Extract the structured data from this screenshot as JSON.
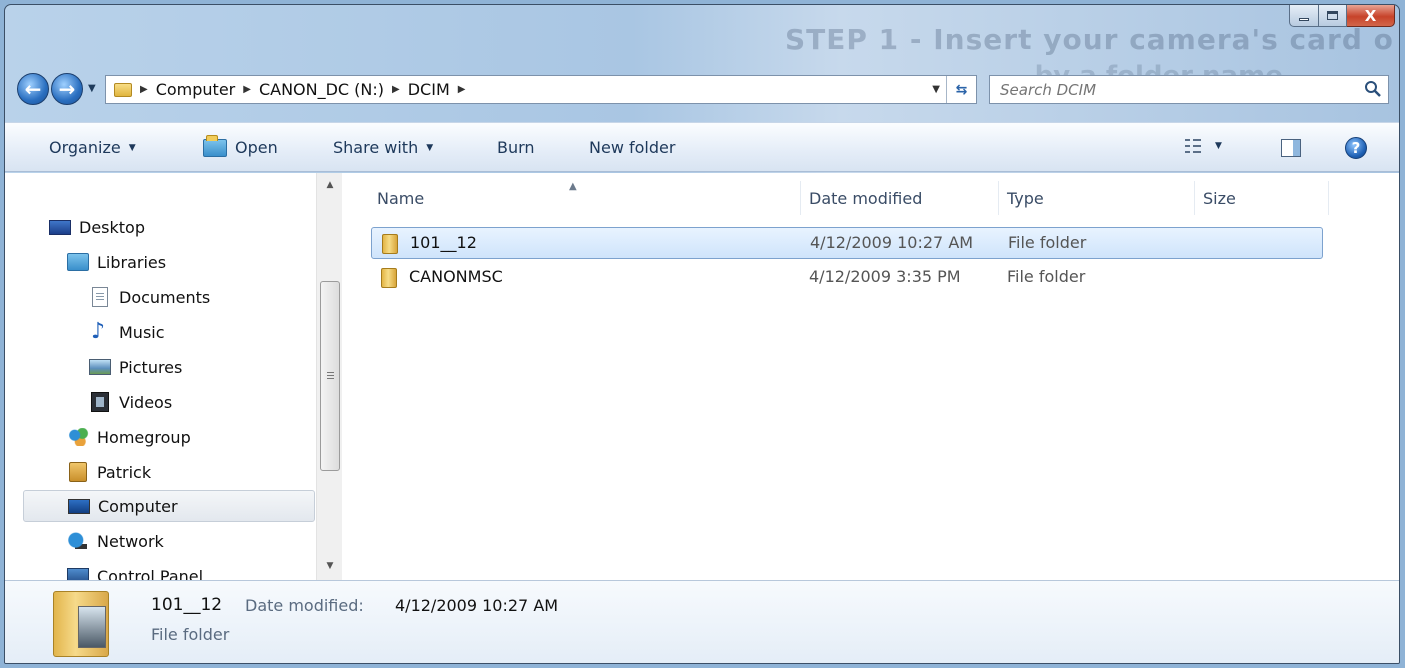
{
  "window": {
    "caption": {
      "close": "X"
    },
    "background_text": [
      "STEP 1 -  Insert your camera's card o",
      "...by a folder name"
    ]
  },
  "navigation": {
    "breadcrumbs": [
      "Computer",
      "CANON_DC (N:)",
      "DCIM"
    ],
    "search_placeholder": "Search DCIM"
  },
  "commands": {
    "organize": "Organize",
    "open": "Open",
    "share_with": "Share with",
    "burn": "Burn",
    "new_folder": "New folder",
    "help": "?"
  },
  "sidebar": {
    "items": [
      {
        "label": "Desktop",
        "icon": "desktop-icon"
      },
      {
        "label": "Libraries",
        "icon": "libraries-icon"
      },
      {
        "label": "Documents",
        "icon": "documents-icon"
      },
      {
        "label": "Music",
        "icon": "music-icon"
      },
      {
        "label": "Pictures",
        "icon": "pictures-icon"
      },
      {
        "label": "Videos",
        "icon": "videos-icon"
      },
      {
        "label": "Homegroup",
        "icon": "homegroup-icon"
      },
      {
        "label": "Patrick",
        "icon": "user-folder-icon"
      },
      {
        "label": "Computer",
        "icon": "computer-icon",
        "selected": true
      },
      {
        "label": "Network",
        "icon": "network-icon"
      },
      {
        "label": "Control Panel",
        "icon": "control-panel-icon"
      }
    ]
  },
  "file_list": {
    "columns": [
      "Name",
      "Date modified",
      "Type",
      "Size"
    ],
    "rows": [
      {
        "name": "101__12",
        "date": "4/12/2009 10:27 AM",
        "type": "File folder",
        "size": "",
        "selected": true
      },
      {
        "name": "CANONMSC",
        "date": "4/12/2009 3:35 PM",
        "type": "File folder",
        "size": ""
      }
    ]
  },
  "details": {
    "name": "101__12",
    "date_label": "Date modified:",
    "date_value": "4/12/2009 10:27 AM",
    "type": "File folder"
  },
  "colors": {
    "selection": "#cfe4fb",
    "command_bar": "#e6eef8",
    "close_button": "#c7432a"
  }
}
